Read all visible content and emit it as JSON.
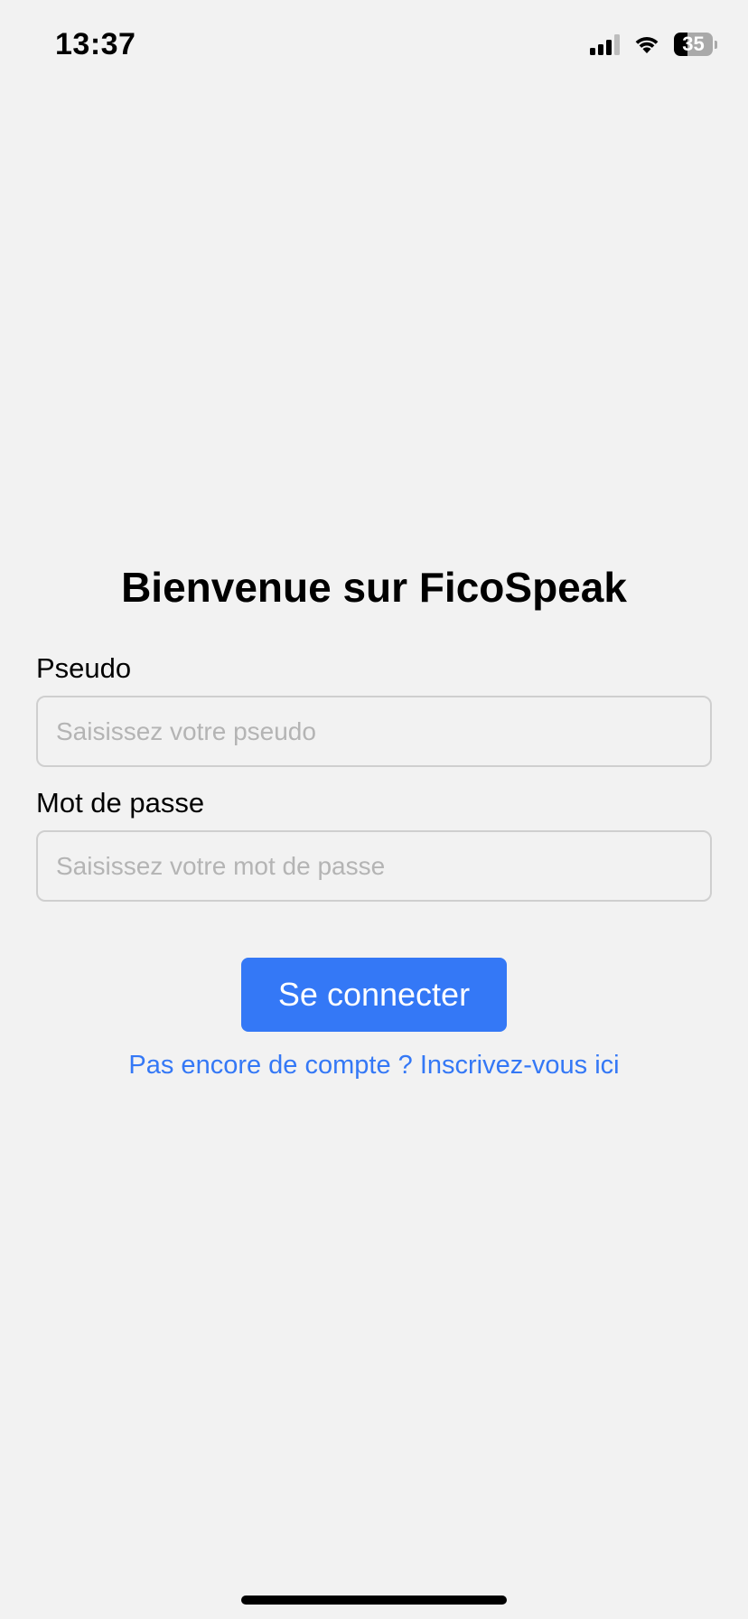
{
  "status_bar": {
    "time": "13:37",
    "battery_level": "35",
    "battery_percent": 35,
    "signal_bars_filled": 3,
    "signal_bars_total": 4
  },
  "login": {
    "title": "Bienvenue sur FicoSpeak",
    "pseudo_label": "Pseudo",
    "pseudo_placeholder": "Saisissez votre pseudo",
    "pseudo_value": "",
    "password_label": "Mot de passe",
    "password_placeholder": "Saisissez votre mot de passe",
    "password_value": "",
    "submit_label": "Se connecter",
    "signup_link": "Pas encore de compte ? Inscrivez-vous ici"
  },
  "colors": {
    "background": "#f2f2f2",
    "accent": "#3478f6",
    "input_border": "#cfcfcf",
    "placeholder": "#b4b4b4"
  },
  "icons": [
    "signal-icon",
    "wifi-icon",
    "battery-icon"
  ]
}
